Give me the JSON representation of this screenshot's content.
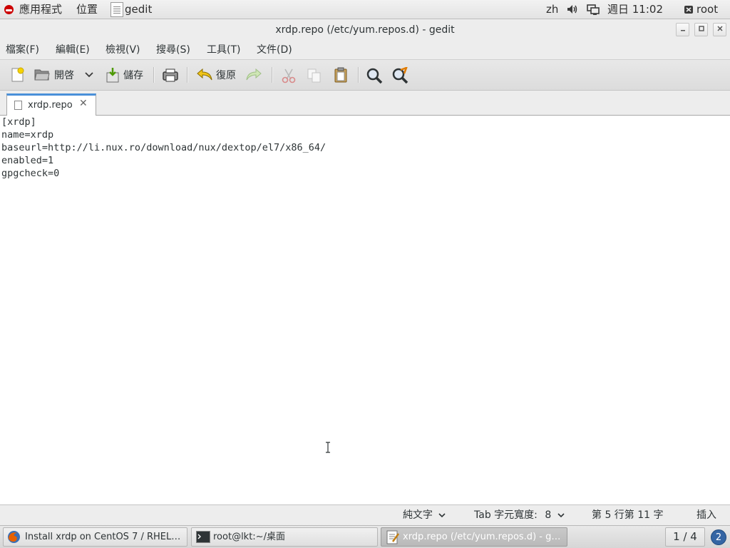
{
  "top_panel": {
    "apps_label": "應用程式",
    "places_label": "位置",
    "app_name": "gedit",
    "lang": "zh",
    "clock": "週日 11:02",
    "user": "root"
  },
  "window": {
    "title": "xrdp.repo (/etc/yum.repos.d) - gedit"
  },
  "menubar": {
    "items": [
      "檔案(F)",
      "編輯(E)",
      "檢視(V)",
      "搜尋(S)",
      "工具(T)",
      "文件(D)"
    ]
  },
  "toolbar": {
    "open_label": "開啓",
    "save_label": "儲存",
    "undo_label": "復原"
  },
  "tab": {
    "label": "xrdp.repo",
    "close_glyph": "✕"
  },
  "document": {
    "lines": [
      "[xrdp]",
      "name=xrdp",
      "baseurl=http://li.nux.ro/download/nux/dextop/el7/x86_64/",
      "enabled=1",
      "gpgcheck=0"
    ]
  },
  "statusbar": {
    "language": "純文字",
    "tab_width_label": "Tab 字元寬度:",
    "tab_width_value": "8",
    "position": "第 5 行第 11 字",
    "mode": "插入"
  },
  "taskbar": {
    "tasks": [
      {
        "label": "Install xrdp on CentOS 7 / RHEL…"
      },
      {
        "label": "root@lkt:~/桌面"
      },
      {
        "label": "xrdp.repo (/etc/yum.repos.d) - g…"
      }
    ],
    "workspace": "1 / 4",
    "notifications": "2"
  },
  "colors": {
    "accent": "#4a90d9",
    "redhat": "#cc0000",
    "notification": "#3465a4"
  }
}
